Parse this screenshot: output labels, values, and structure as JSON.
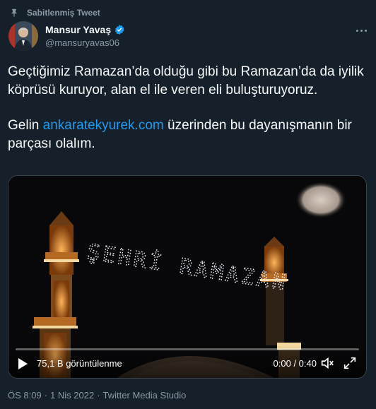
{
  "pinned_label": "Sabitlenmiş Tweet",
  "author": {
    "name": "Mansur Yavaş",
    "handle": "@mansuryavas06"
  },
  "tweet": {
    "line1": "Geçtiğimiz Ramazan’da olduğu gibi bu Ramazan’da da iyilik köprüsü kuruyor, alan el ile veren eli buluşturuyoruz.",
    "line2_before": "Gelin ",
    "link": "ankaratekyurek.com",
    "line2_after": " üzerinden bu dayanışmanın bir parçası olalım."
  },
  "video": {
    "scene_text": "ŞEHRİ RAMAZAN",
    "views": "75,1 B görüntülenme",
    "time": "0:00 / 0:40",
    "progress": 0
  },
  "meta": {
    "time": "ÖS 8:09",
    "date": "1 Nis 2022",
    "source": "Twitter Media Studio"
  },
  "colors": {
    "background": "#15202b",
    "link": "#1d9bf0",
    "muted": "#8b98a5",
    "verified": "#1d9bf0"
  }
}
